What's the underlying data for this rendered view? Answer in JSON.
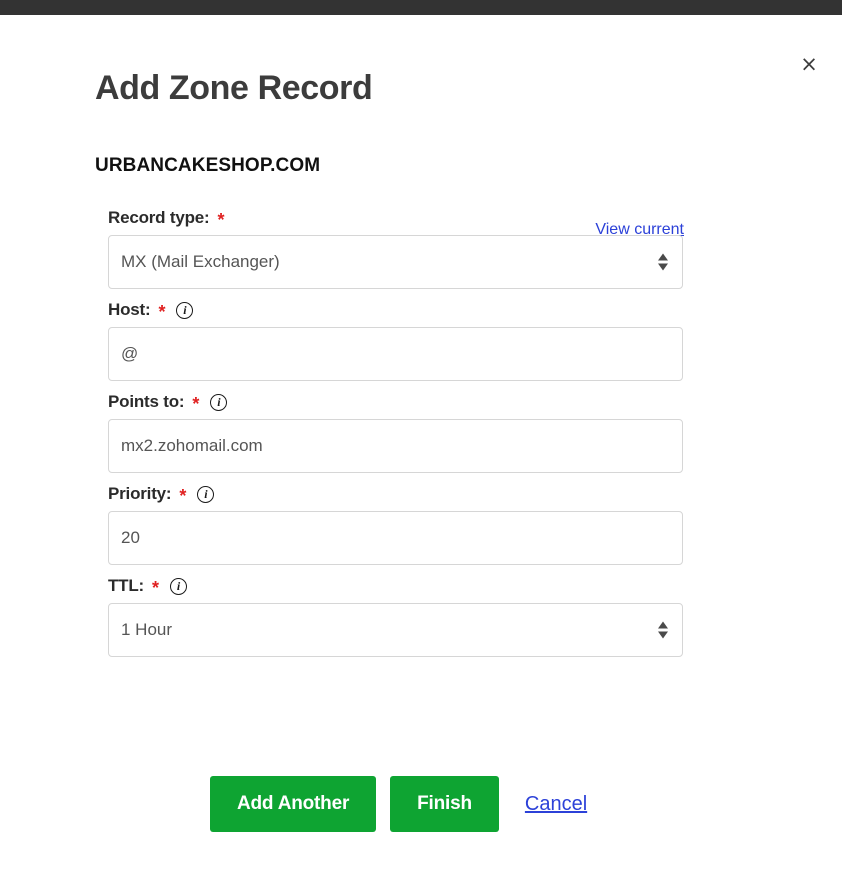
{
  "window": {
    "topbar_color": "#333333",
    "close_icon": "×"
  },
  "modal": {
    "title": "Add Zone Record",
    "domain": "URBANCAKESHOP.COM",
    "view_current_label": "View current"
  },
  "form": {
    "fields": [
      {
        "label": "Record type:",
        "required_marker": "*",
        "control_type": "select",
        "value": "MX (Mail Exchanger)",
        "has_info_icon": false
      },
      {
        "label": "Host:",
        "required_marker": "*",
        "control_type": "text",
        "value": "@",
        "has_info_icon": true
      },
      {
        "label": "Points to:",
        "required_marker": "*",
        "control_type": "text",
        "value": "mx2.zohomail.com",
        "has_info_icon": true
      },
      {
        "label": "Priority:",
        "required_marker": "*",
        "control_type": "text",
        "value": "20",
        "has_info_icon": true
      },
      {
        "label": "TTL:",
        "required_marker": "*",
        "control_type": "select",
        "value": "1 Hour",
        "has_info_icon": true
      }
    ]
  },
  "actions": {
    "add_another_label": "Add Another",
    "finish_label": "Finish",
    "cancel_label": "Cancel",
    "button_color": "#0ea432",
    "link_color": "#2c41d8"
  }
}
